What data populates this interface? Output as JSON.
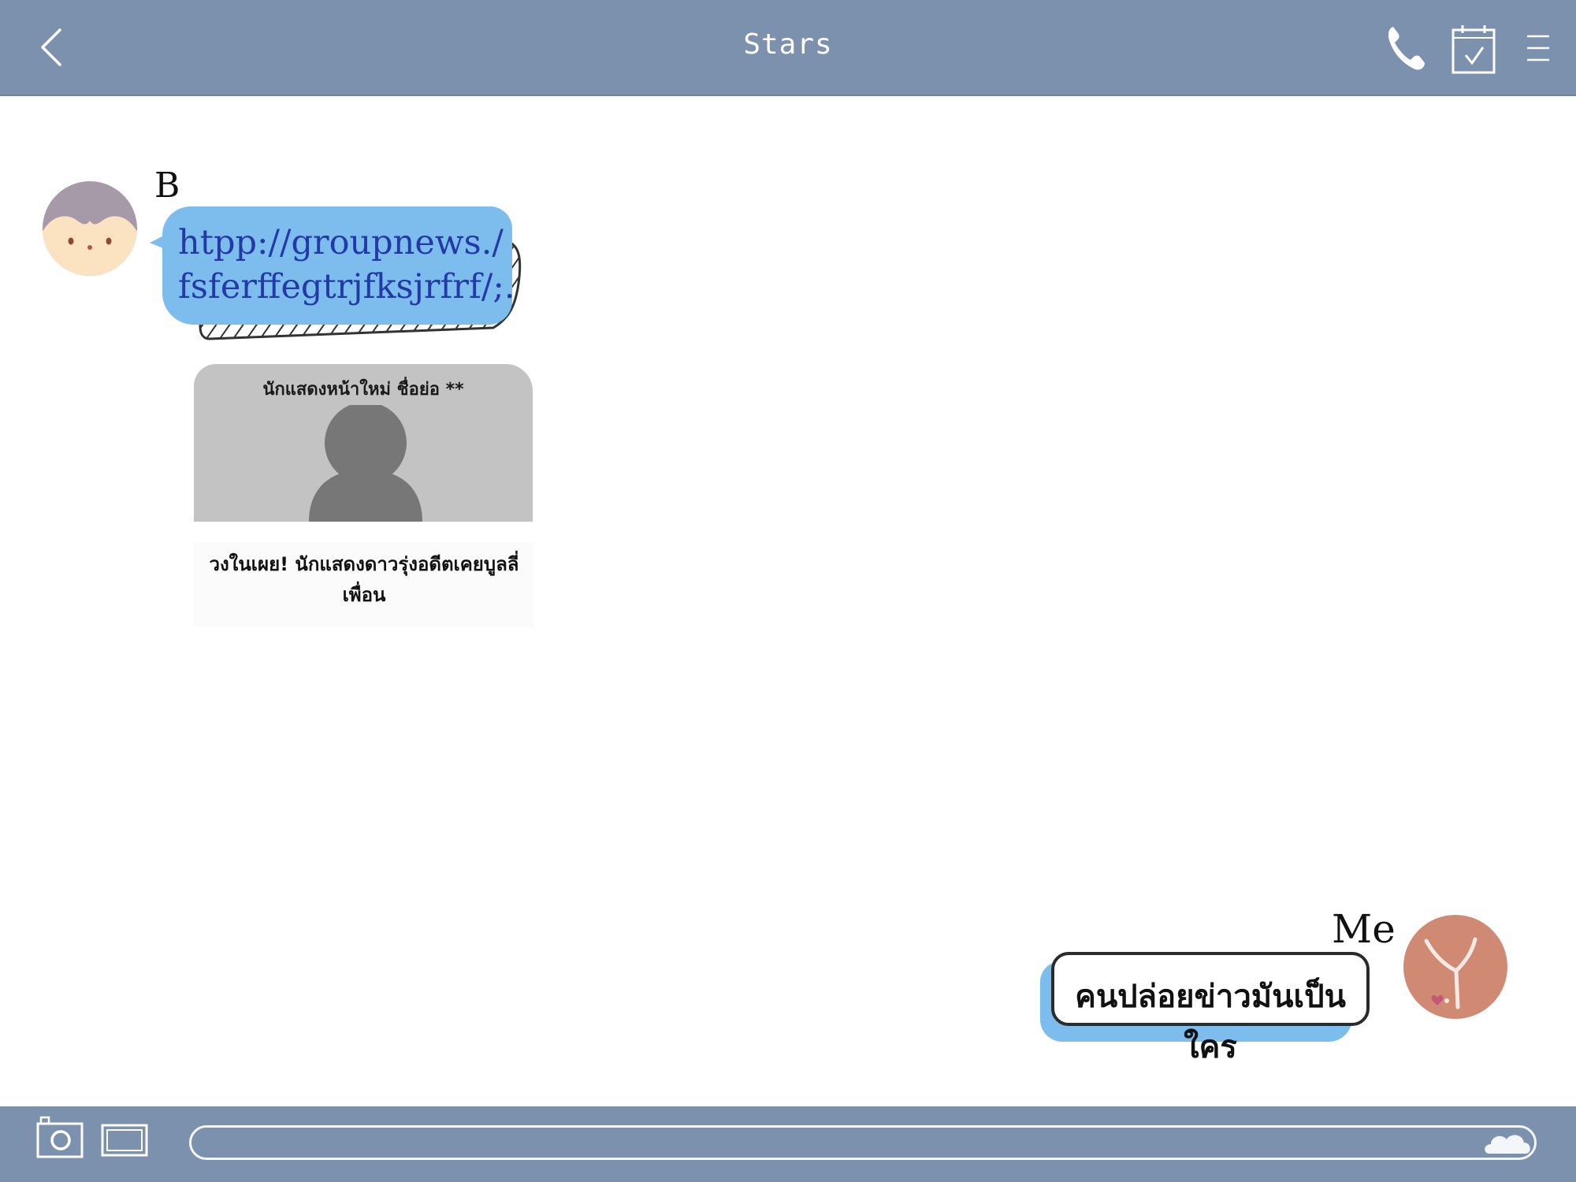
{
  "header": {
    "title": "Stars",
    "back_icon": "chevron-left-icon",
    "call_icon": "phone-icon",
    "calendar_icon": "calendar-check-icon",
    "menu_icon": "menu-icon"
  },
  "colors": {
    "bar": "#7b91ae",
    "bubble_blue": "#7cbdee",
    "link": "#233aa6",
    "preview_gray": "#c3c3c3",
    "avatar_b": "#a79aa8",
    "avatar_me": "#d08a73"
  },
  "messages": [
    {
      "sender": "B",
      "link_line1": "htpp://groupnews./",
      "link_line2": "fsferffegtrjfksjrfrf/;.",
      "preview": {
        "headline": "นักแสดงหน้าใหม่ ชื่อย่อ **",
        "caption": "วงในเผย! นักแสดงดาวรุ่งอดีตเคยบูลลี่เพื่อน"
      }
    },
    {
      "sender": "Me",
      "text": "คนปล่อยข่าวมันเป็นใคร"
    }
  ],
  "composer": {
    "camera_icon": "camera-icon",
    "image_icon": "image-icon",
    "send_icon": "cloud-icon",
    "placeholder": ""
  }
}
